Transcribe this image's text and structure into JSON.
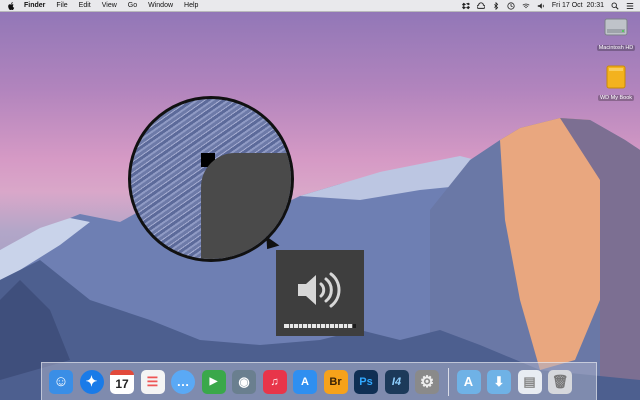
{
  "menubar": {
    "apple_icon": "apple-icon",
    "menus": [
      "Finder",
      "File",
      "Edit",
      "View",
      "Go",
      "Window",
      "Help"
    ],
    "clock": "Fri 17 Oct  20:31",
    "status_icons": [
      "dropbox-icon",
      "creative-cloud-icon",
      "bluetooth-icon",
      "time-machine-icon",
      "wifi-icon",
      "volume-icon",
      "spotlight-icon",
      "notification-center-icon"
    ]
  },
  "desktop_icons": [
    {
      "label": "Macintosh HD",
      "icon": "hard-drive-icon"
    },
    {
      "label": "WD My Book",
      "icon": "external-drive-icon"
    }
  ],
  "volume_hud": {
    "icon": "speaker-icon",
    "level": 0.95,
    "segments": 16,
    "colors": {
      "background": "#3e3e3e",
      "fill": "#e8e8e8"
    }
  },
  "magnifier": {
    "icon": "zoom-lens"
  },
  "dock": {
    "apps": [
      {
        "name": "finder",
        "icon": "finder-icon",
        "glyph": "",
        "color": "#3a8ee6"
      },
      {
        "name": "safari",
        "icon": "safari-icon",
        "glyph": "",
        "color": "#1a7be8"
      },
      {
        "name": "calendar",
        "icon": "calendar-icon",
        "glyph": "17",
        "color": "#ffffff"
      },
      {
        "name": "reminders",
        "icon": "reminders-icon",
        "glyph": "",
        "color": "#f4f4f4"
      },
      {
        "name": "messages",
        "icon": "messages-icon",
        "glyph": "",
        "color": "#5aa9f5"
      },
      {
        "name": "facetime",
        "icon": "facetime-icon",
        "glyph": "",
        "color": "#3aa84a"
      },
      {
        "name": "iphoto",
        "icon": "photos-icon",
        "glyph": "",
        "color": "#6a7f8f"
      },
      {
        "name": "itunes",
        "icon": "itunes-icon",
        "glyph": "♫",
        "color": "#e8354a"
      },
      {
        "name": "app-store",
        "icon": "app-store-icon",
        "glyph": "A",
        "color": "#2f8ff0"
      },
      {
        "name": "bridge",
        "icon": "bridge-icon",
        "glyph": "Br",
        "color": "#f6a21a"
      },
      {
        "name": "photoshop",
        "icon": "photoshop-icon",
        "glyph": "Ps",
        "color": "#0f2f54"
      },
      {
        "name": "indesign-14",
        "icon": "app-14-icon",
        "glyph": "I4",
        "color": "#1c3a5a"
      },
      {
        "name": "system-preferences",
        "icon": "gear-icon",
        "glyph": "",
        "color": "#8a8a8a"
      }
    ],
    "stacks": [
      {
        "name": "applications",
        "icon": "applications-folder-icon",
        "color": "#6fb2e6"
      },
      {
        "name": "downloads",
        "icon": "downloads-folder-icon",
        "color": "#6fb2e6"
      },
      {
        "name": "documents",
        "icon": "documents-stack-icon",
        "color": "#e8ecf2"
      },
      {
        "name": "trash",
        "icon": "trash-icon",
        "color": "#d6d8dc"
      }
    ]
  }
}
